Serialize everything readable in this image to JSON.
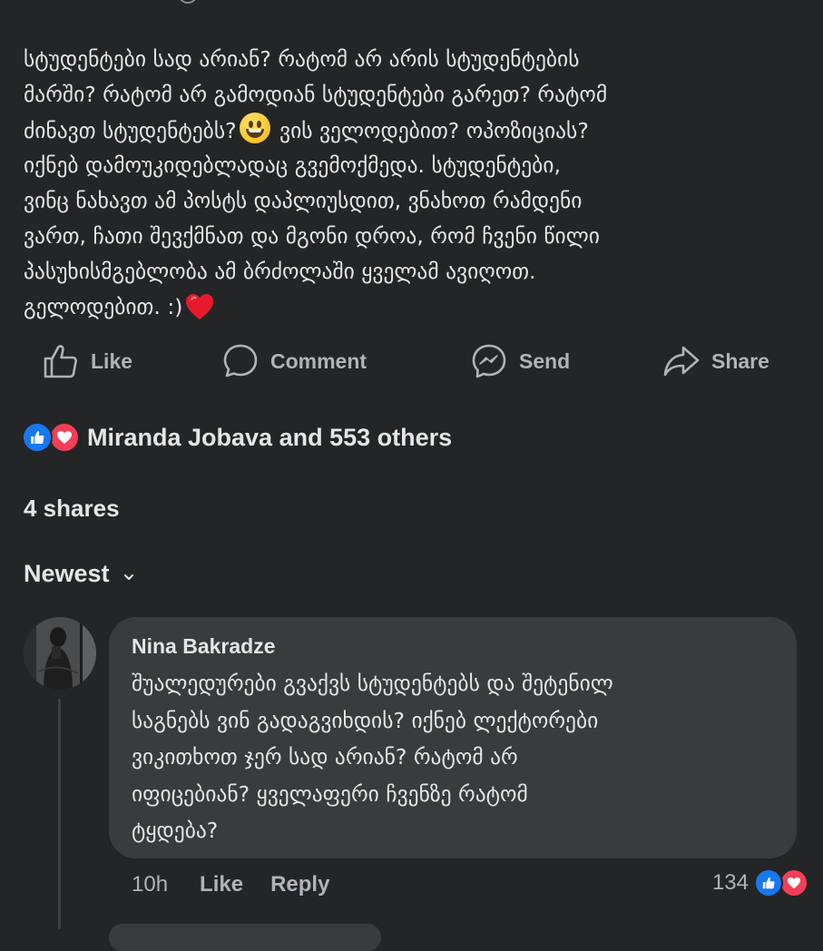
{
  "post": {
    "text_line1": "სტუდენტები სად არიან? რატომ არ არის სტუდენტების",
    "text_line2": "მარში? რატომ არ გამოდიან სტუდენტები გარეთ? რატომ",
    "text_line3a": "ძინავთ სტუდენტებს?",
    "text_line3b": " ვის ველოდებით? ოპოზიციას?",
    "text_line4": "იქნებ დამოუკიდებლადაც გვემოქმედა. სტუდენტები,",
    "text_line5": "ვინც ნახავთ ამ პოსტს დაპლიუსდით, ვნახოთ რამდენი",
    "text_line6": "ვართ, ჩათი შევქმნათ და მგონი დროა, რომ ჩვენი წილი",
    "text_line7": "პასუხისმგებლობა ამ ბრძოლაში ყველამ ავიღოთ.",
    "text_line8": "გელოდებით. :)",
    "emoji1": "grinning-face-emoji",
    "emoji2": "red-heart-emoji"
  },
  "actions": {
    "like": "Like",
    "comment": "Comment",
    "send": "Send",
    "share": "Share"
  },
  "reactions": {
    "summary": "Miranda Jobava and 553 others",
    "icons": [
      "like-icon",
      "love-icon"
    ],
    "like_color": "#1877f2",
    "love_color": "#f33e58"
  },
  "shares": "4 shares",
  "sort": {
    "label": "Newest"
  },
  "comment": {
    "author": "Nina Bakradze",
    "line1": "შუალედურები გვაქვს სტუდენტებს და შეტენილ",
    "line2": "საგნებს ვინ გადაგვიხდის? იქნებ ლექტორები",
    "line3": "ვიკითხოთ ჯერ სად არიან? რატომ არ",
    "line4": "იფიცებიან? ყველაფერი ჩვენზე რატომ",
    "line5": "ტყდება?",
    "time": "10h",
    "like": "Like",
    "reply": "Reply",
    "reaction_count": "134"
  },
  "colors": {
    "background": "#242526",
    "bubble": "#3a3b3c",
    "primary_text": "#e4e6eb",
    "secondary_text": "#b0b3b8"
  }
}
